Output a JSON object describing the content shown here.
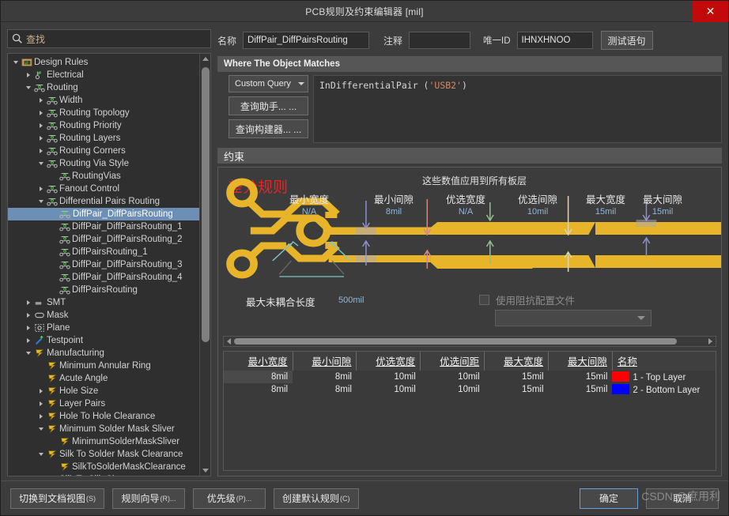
{
  "window": {
    "title": "PCB规则及约束编辑器 [mil]",
    "close_label": "✕"
  },
  "sidebar": {
    "search": {
      "placeholder": "查找",
      "value": ""
    },
    "tree": [
      {
        "label": "Design Rules",
        "depth": 0,
        "twist": "down",
        "icon": "folder-rules-icon",
        "selected": false
      },
      {
        "label": "Electrical",
        "depth": 1,
        "twist": "right",
        "icon": "electrical-icon",
        "selected": false
      },
      {
        "label": "Routing",
        "depth": 1,
        "twist": "down",
        "icon": "routing-icon",
        "selected": false
      },
      {
        "label": "Width",
        "depth": 2,
        "twist": "right",
        "icon": "routing-icon",
        "selected": false
      },
      {
        "label": "Routing Topology",
        "depth": 2,
        "twist": "right",
        "icon": "routing-icon",
        "selected": false
      },
      {
        "label": "Routing Priority",
        "depth": 2,
        "twist": "right",
        "icon": "routing-icon",
        "selected": false
      },
      {
        "label": "Routing Layers",
        "depth": 2,
        "twist": "right",
        "icon": "routing-icon",
        "selected": false
      },
      {
        "label": "Routing Corners",
        "depth": 2,
        "twist": "right",
        "icon": "routing-icon",
        "selected": false
      },
      {
        "label": "Routing Via Style",
        "depth": 2,
        "twist": "down",
        "icon": "routing-icon",
        "selected": false
      },
      {
        "label": "RoutingVias",
        "depth": 3,
        "twist": "none",
        "icon": "routing-icon",
        "selected": false
      },
      {
        "label": "Fanout Control",
        "depth": 2,
        "twist": "right",
        "icon": "routing-icon",
        "selected": false
      },
      {
        "label": "Differential Pairs Routing",
        "depth": 2,
        "twist": "down",
        "icon": "routing-icon",
        "selected": false
      },
      {
        "label": "DiffPair_DiffPairsRouting",
        "depth": 3,
        "twist": "none",
        "icon": "routing-icon",
        "selected": true
      },
      {
        "label": "DiffPair_DiffPairsRouting_1",
        "depth": 3,
        "twist": "none",
        "icon": "routing-icon",
        "selected": false
      },
      {
        "label": "DiffPair_DiffPairsRouting_2",
        "depth": 3,
        "twist": "none",
        "icon": "routing-icon",
        "selected": false
      },
      {
        "label": "DiffPairsRouting_1",
        "depth": 3,
        "twist": "none",
        "icon": "routing-icon",
        "selected": false
      },
      {
        "label": "DiffPair_DiffPairsRouting_3",
        "depth": 3,
        "twist": "none",
        "icon": "routing-icon",
        "selected": false
      },
      {
        "label": "DiffPair_DiffPairsRouting_4",
        "depth": 3,
        "twist": "none",
        "icon": "routing-icon",
        "selected": false
      },
      {
        "label": "DiffPairsRouting",
        "depth": 3,
        "twist": "none",
        "icon": "routing-icon",
        "selected": false
      },
      {
        "label": "SMT",
        "depth": 1,
        "twist": "right",
        "icon": "smt-icon",
        "selected": false
      },
      {
        "label": "Mask",
        "depth": 1,
        "twist": "right",
        "icon": "mask-icon",
        "selected": false
      },
      {
        "label": "Plane",
        "depth": 1,
        "twist": "right",
        "icon": "plane-icon",
        "selected": false
      },
      {
        "label": "Testpoint",
        "depth": 1,
        "twist": "right",
        "icon": "testpoint-icon",
        "selected": false
      },
      {
        "label": "Manufacturing",
        "depth": 1,
        "twist": "down",
        "icon": "manufacturing-icon",
        "selected": false
      },
      {
        "label": "Minimum Annular Ring",
        "depth": 2,
        "twist": "none",
        "icon": "manufacturing-icon",
        "selected": false
      },
      {
        "label": "Acute Angle",
        "depth": 2,
        "twist": "none",
        "icon": "manufacturing-icon",
        "selected": false
      },
      {
        "label": "Hole Size",
        "depth": 2,
        "twist": "right",
        "icon": "manufacturing-icon",
        "selected": false
      },
      {
        "label": "Layer Pairs",
        "depth": 2,
        "twist": "right",
        "icon": "manufacturing-icon",
        "selected": false
      },
      {
        "label": "Hole To Hole Clearance",
        "depth": 2,
        "twist": "right",
        "icon": "manufacturing-icon",
        "selected": false
      },
      {
        "label": "Minimum Solder Mask Sliver",
        "depth": 2,
        "twist": "down",
        "icon": "manufacturing-icon",
        "selected": false
      },
      {
        "label": "MinimumSolderMaskSliver",
        "depth": 3,
        "twist": "none",
        "icon": "manufacturing-icon",
        "selected": false
      },
      {
        "label": "Silk To Solder Mask Clearance",
        "depth": 2,
        "twist": "down",
        "icon": "manufacturing-icon",
        "selected": false
      },
      {
        "label": "SilkToSolderMaskClearance",
        "depth": 3,
        "twist": "none",
        "icon": "manufacturing-icon",
        "selected": false
      },
      {
        "label": "Silk To Silk Cl...",
        "depth": 2,
        "twist": "down",
        "icon": "manufacturing-icon",
        "selected": false
      }
    ]
  },
  "form": {
    "name_label": "名称",
    "name_value": "DiffPair_DiffPairsRouting",
    "comment_label": "注释",
    "comment_value": "",
    "uid_label": "唯一ID",
    "uid_value": "IHNXHNOO",
    "test_query_button": "测试语句"
  },
  "where_section": {
    "title": "Where The Object Matches",
    "scope_selected": "Custom Query",
    "query_prefix": "InDifferentialPair (",
    "query_string": "'USB2'",
    "query_suffix": ")",
    "query_helper_button": "查询助手... ...",
    "query_builder_button": "查询构建器... ..."
  },
  "constraints_section": {
    "title": "约束",
    "applies_note": "这些数值应用到所有板层",
    "red_stamp": "差分规则",
    "columns": [
      {
        "head": "最小宽度",
        "value": "N/A"
      },
      {
        "head": "最小间隙",
        "value": "8mil"
      },
      {
        "head": "优选宽度",
        "value": "N/A"
      },
      {
        "head": "优选间隙",
        "value": "10mil"
      },
      {
        "head": "最大宽度",
        "value": "15mil"
      },
      {
        "head": "最大间隙",
        "value": "15mil"
      }
    ],
    "max_uncoupled_label": "最大未耦合长度",
    "max_uncoupled_value": "500mil",
    "impedance_checkbox_label": "使用阻抗配置文件",
    "impedance_checked": false,
    "impedance_profile_value": ""
  },
  "layer_table": {
    "headers": [
      "最小宽度",
      "最小间隙",
      "优选宽度",
      "优选间距",
      "最大宽度",
      "最大间隙",
      "名称"
    ],
    "rows": [
      {
        "cells": [
          "8mil",
          "8mil",
          "10mil",
          "10mil",
          "15mil",
          "15mil"
        ],
        "swatch": "#ff0000",
        "name": "1 - Top Layer",
        "highlighted": true
      },
      {
        "cells": [
          "8mil",
          "8mil",
          "10mil",
          "10mil",
          "15mil",
          "15mil"
        ],
        "swatch": "#0000ff",
        "name": "2 - Bottom Layer",
        "highlighted": false
      }
    ]
  },
  "footer": {
    "buttons_left": [
      {
        "label": "切换到文档视图",
        "accel": "(S)"
      },
      {
        "label": "规则向导",
        "accel": "(R)..."
      },
      {
        "label": "优先级",
        "accel": "(P)..."
      },
      {
        "label": "创建默认规则",
        "accel": "(C)"
      }
    ],
    "buttons_right": [
      {
        "label": "确定",
        "accel": "",
        "primary": true
      },
      {
        "label": "取消",
        "accel": "",
        "primary": false
      }
    ]
  },
  "watermark": "CSDN @庶用利",
  "colors": {
    "trace": "#e8b42a",
    "accent_blue": "#8fb8dd",
    "red_stamp": "#f02020",
    "close_red": "#c20a0a",
    "selection": "#6d8fb5",
    "top_layer": "#ff0000",
    "bottom_layer": "#0000ff"
  }
}
